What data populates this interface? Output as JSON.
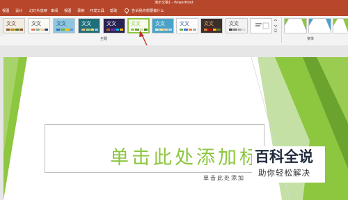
{
  "window": {
    "title": "演示文稿1 - PowerPoint"
  },
  "menu": {
    "items": [
      "视图",
      "设计",
      "幻灯片放映",
      "审阅",
      "视图",
      "录制",
      "开发工具",
      "帮助"
    ],
    "tell_me": "告诉我你想要做什么"
  },
  "design": {
    "themes_group_label": "主题",
    "variants_group_label": "变体",
    "theme_thumbs": [
      {
        "label": "文文"
      },
      {
        "label": "文文"
      },
      {
        "label": "文文"
      },
      {
        "label": "文文"
      },
      {
        "label": "文文"
      },
      {
        "label": "文文"
      },
      {
        "label": "文文"
      },
      {
        "label": "文文"
      },
      {
        "label": "文文"
      },
      {
        "label": "文文"
      }
    ]
  },
  "slide": {
    "title_placeholder": "单击此处添加标",
    "subtitle_placeholder": "单击此处添加"
  },
  "watermark": {
    "title": "百科全说",
    "subtitle": "助你轻松解决"
  },
  "colors": {
    "accent": "#b7472a",
    "theme_green": "#8dc63f",
    "dark_green": "#6aa32e",
    "arrow": "#c0302a"
  }
}
